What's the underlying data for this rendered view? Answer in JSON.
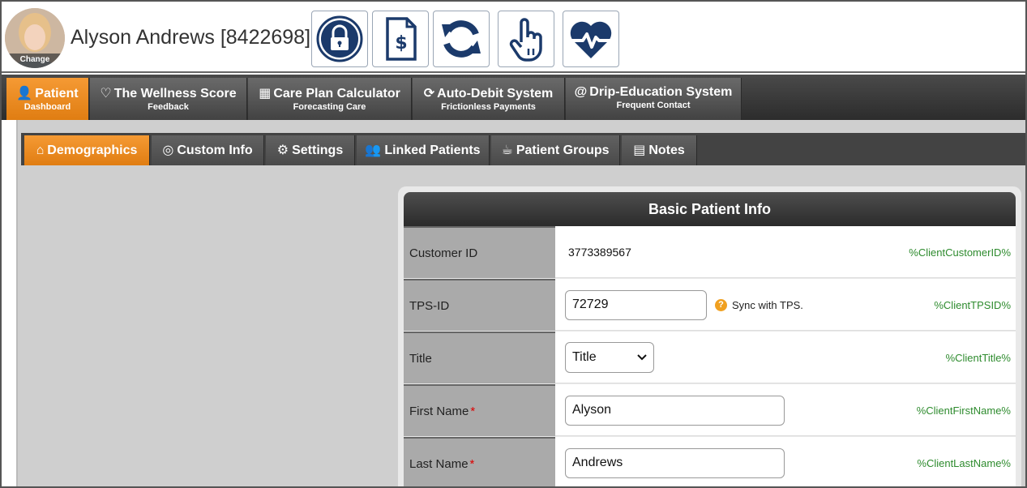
{
  "patient": {
    "name": "Alyson Andrews [8422698]",
    "avatar_change_label": "Change"
  },
  "header_buttons": [
    {
      "icon": "lock-icon"
    },
    {
      "icon": "invoice-icon"
    },
    {
      "icon": "refresh-icon"
    },
    {
      "icon": "touch-hand-icon"
    },
    {
      "icon": "heart-pulse-icon"
    }
  ],
  "main_tabs": [
    {
      "title": "Patient",
      "subtitle": "Dashboard",
      "icon": "user-icon",
      "glyph": "👤"
    },
    {
      "title": "The Wellness Score",
      "subtitle": "Feedback",
      "icon": "heartbeat-icon",
      "glyph": "♡"
    },
    {
      "title": "Care Plan Calculator",
      "subtitle": "Forecasting Care",
      "icon": "calculator-icon",
      "glyph": "▦"
    },
    {
      "title": "Auto-Debit System",
      "subtitle": "Frictionless Payments",
      "icon": "refresh-icon",
      "glyph": "⟳"
    },
    {
      "title": "Drip-Education System",
      "subtitle": "Frequent Contact",
      "icon": "at-icon",
      "glyph": "@"
    }
  ],
  "sub_tabs": [
    {
      "label": "Demographics",
      "icon": "home-icon",
      "glyph": "⌂"
    },
    {
      "label": "Custom Info",
      "icon": "target-icon",
      "glyph": "◎"
    },
    {
      "label": "Settings",
      "icon": "gear-icon",
      "glyph": "⚙"
    },
    {
      "label": "Linked Patients",
      "icon": "users-icon",
      "glyph": "👥"
    },
    {
      "label": "Patient Groups",
      "icon": "groups-icon",
      "glyph": "☕"
    },
    {
      "label": "Notes",
      "icon": "note-icon",
      "glyph": "▤"
    }
  ],
  "panel": {
    "title": "Basic Patient Info",
    "customer_id": {
      "label": "Customer ID",
      "value": "3773389567",
      "token": "%ClientCustomerID%"
    },
    "tps_id": {
      "label": "TPS-ID",
      "value": "72729",
      "help": "?",
      "sync_text": "Sync with TPS.",
      "token": "%ClientTPSID%"
    },
    "title_field": {
      "label": "Title",
      "value": "Title",
      "token": "%ClientTitle%"
    },
    "first_name": {
      "label": "First Name",
      "required": "*",
      "value": "Alyson",
      "token": "%ClientFirstName%"
    },
    "last_name": {
      "label": "Last Name",
      "required": "*",
      "value": "Andrews",
      "token": "%ClientLastName%"
    }
  },
  "colors": {
    "accent": "#f0891f",
    "brand_icon": "#1b3a6b",
    "token_green": "#2e8b2e"
  }
}
